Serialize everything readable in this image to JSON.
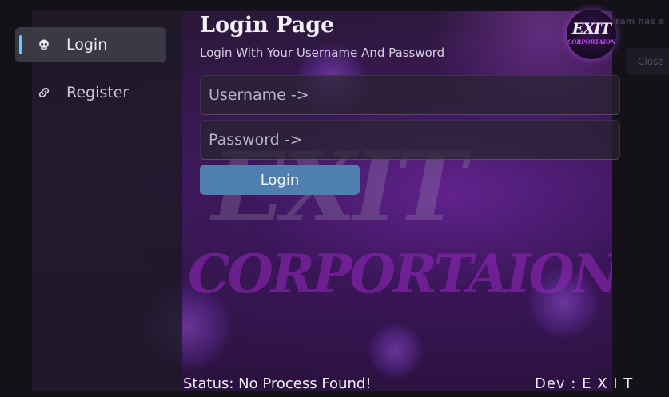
{
  "background": {
    "note": "ram has e",
    "close_label": "Close"
  },
  "sidebar": {
    "items": [
      {
        "label": "Login",
        "icon": "skull-icon",
        "active": true
      },
      {
        "label": "Register",
        "icon": "link-icon",
        "active": false
      }
    ]
  },
  "header": {
    "title": "Login Page",
    "subtitle": "Login With Your Username And Password"
  },
  "logo": {
    "line1": "EXIT",
    "line2": "CORPORTAION"
  },
  "background_art": {
    "line1": "EXIT",
    "line2": "CORPORTAION"
  },
  "form": {
    "username_placeholder": "Username ->",
    "username_value": "",
    "password_placeholder": "Password ->",
    "password_value": "",
    "login_label": "Login"
  },
  "status": {
    "text": "Status: No Process Found!",
    "dev": "Dev : E X I T"
  },
  "colors": {
    "accent_indicator": "#60cdff",
    "login_button": "#4f7fae",
    "logo_purple": "#c34cf0"
  }
}
